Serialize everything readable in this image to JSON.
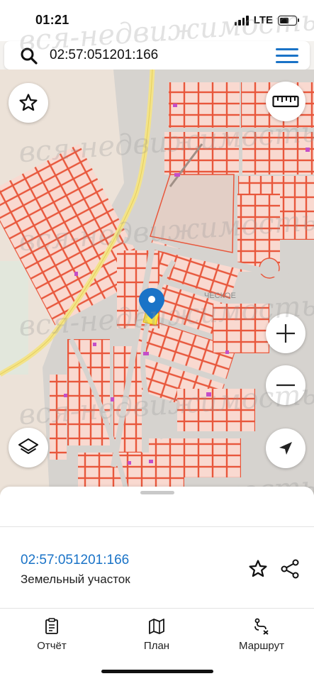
{
  "status": {
    "time": "01:21",
    "network": "LTE"
  },
  "search": {
    "query": "02:57:051201:166",
    "search_icon": "search-icon",
    "menu_icon": "hamburger-menu-icon"
  },
  "map": {
    "buttons": {
      "favorite": "star-icon",
      "ruler": "ruler-icon",
      "zoom_in": "plus-icon",
      "zoom_out": "minus-icon",
      "layers": "layers-icon",
      "locate": "navigation-arrow-icon"
    },
    "marker": "location-pin-icon",
    "colors": {
      "parcel_fill": "#f9d9d0",
      "parcel_stroke": "#e8573c",
      "road": "#d9d6d2",
      "highlight": "#c44ec8",
      "pin": "#1a73c7"
    },
    "map_label": "ЧЕСКОЕ"
  },
  "watermark": "вся-недвижимость.net",
  "sheet": {
    "parcel_id": "02:57:051201:166",
    "parcel_type": "Земельный участок"
  },
  "tabs": [
    {
      "label": "Отчёт",
      "icon": "report-icon"
    },
    {
      "label": "План",
      "icon": "map-icon"
    },
    {
      "label": "Маршрут",
      "icon": "route-icon"
    }
  ]
}
